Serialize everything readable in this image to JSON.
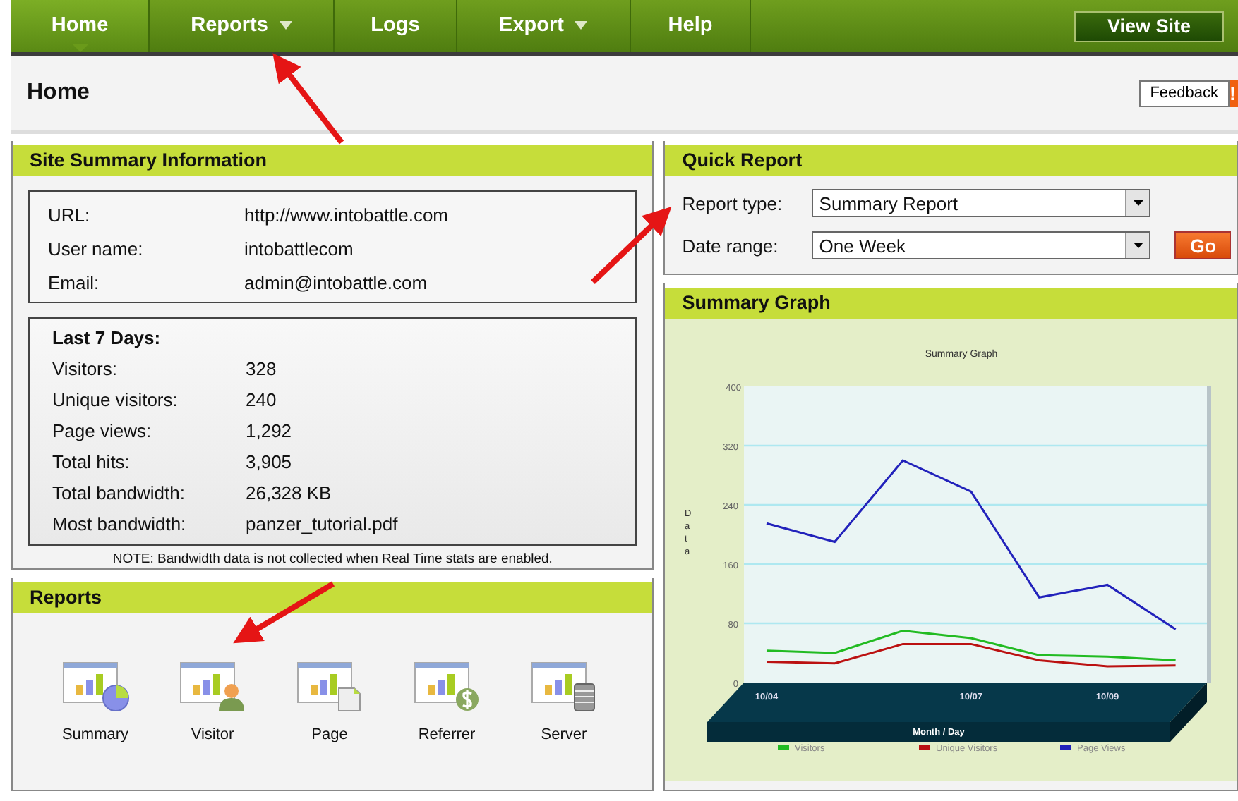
{
  "nav": {
    "items": [
      {
        "label": "Home",
        "selected": true,
        "dropdown": false
      },
      {
        "label": "Reports",
        "selected": false,
        "dropdown": true
      },
      {
        "label": "Logs",
        "selected": false,
        "dropdown": false
      },
      {
        "label": "Export",
        "selected": false,
        "dropdown": true
      },
      {
        "label": "Help",
        "selected": false,
        "dropdown": false
      }
    ],
    "view_site": "View Site"
  },
  "page_title": "Home",
  "feedback": "Feedback",
  "feedback_badge": "!",
  "site_summary": {
    "title": "Site Summary Information",
    "info": [
      {
        "label": "URL:",
        "value": "http://www.intobattle.com"
      },
      {
        "label": "User name:",
        "value": "intobattlecom"
      },
      {
        "label": "Email:",
        "value": "admin@intobattle.com"
      }
    ],
    "stats_title": "Last 7 Days:",
    "stats": [
      {
        "label": "Visitors:",
        "value": "328"
      },
      {
        "label": "Unique visitors:",
        "value": "240"
      },
      {
        "label": "Page views:",
        "value": "1,292"
      },
      {
        "label": "Total hits:",
        "value": "3,905"
      },
      {
        "label": "Total bandwidth:",
        "value": "26,328 KB"
      },
      {
        "label": "Most bandwidth:",
        "value": "panzer_tutorial.pdf"
      }
    ],
    "note": "NOTE: Bandwidth data is not collected when Real Time stats are enabled."
  },
  "reports": {
    "title": "Reports",
    "items": [
      {
        "label": "Summary",
        "kind": "pie"
      },
      {
        "label": "Visitor",
        "kind": "person"
      },
      {
        "label": "Page",
        "kind": "page"
      },
      {
        "label": "Referrer",
        "kind": "dollar"
      },
      {
        "label": "Server",
        "kind": "server"
      }
    ]
  },
  "quick_report": {
    "title": "Quick Report",
    "fields": [
      {
        "label": "Report type:",
        "value": "Summary Report"
      },
      {
        "label": "Date range:",
        "value": "One Week"
      }
    ],
    "go": "Go"
  },
  "summary_graph": {
    "title": "Summary Graph",
    "chart_data": {
      "type": "line",
      "title": "Summary Graph",
      "xlabel": "Month / Day",
      "ylabel": "Data",
      "categories": [
        "10/04",
        null,
        null,
        "10/07",
        null,
        "10/09",
        null
      ],
      "grid": true,
      "legend": "bottom",
      "ylim": [
        0,
        400
      ],
      "yticks": [
        0,
        80,
        160,
        240,
        320,
        400
      ],
      "series": [
        {
          "name": "Visitors",
          "color": "#22bb22",
          "values": [
            43,
            40,
            70,
            60,
            37,
            35,
            30
          ]
        },
        {
          "name": "Unique Visitors",
          "color": "#bb1111",
          "values": [
            28,
            26,
            52,
            52,
            30,
            22,
            23
          ]
        },
        {
          "name": "Page Views",
          "color": "#2222bb",
          "values": [
            215,
            190,
            300,
            258,
            115,
            132,
            72
          ]
        }
      ]
    }
  }
}
